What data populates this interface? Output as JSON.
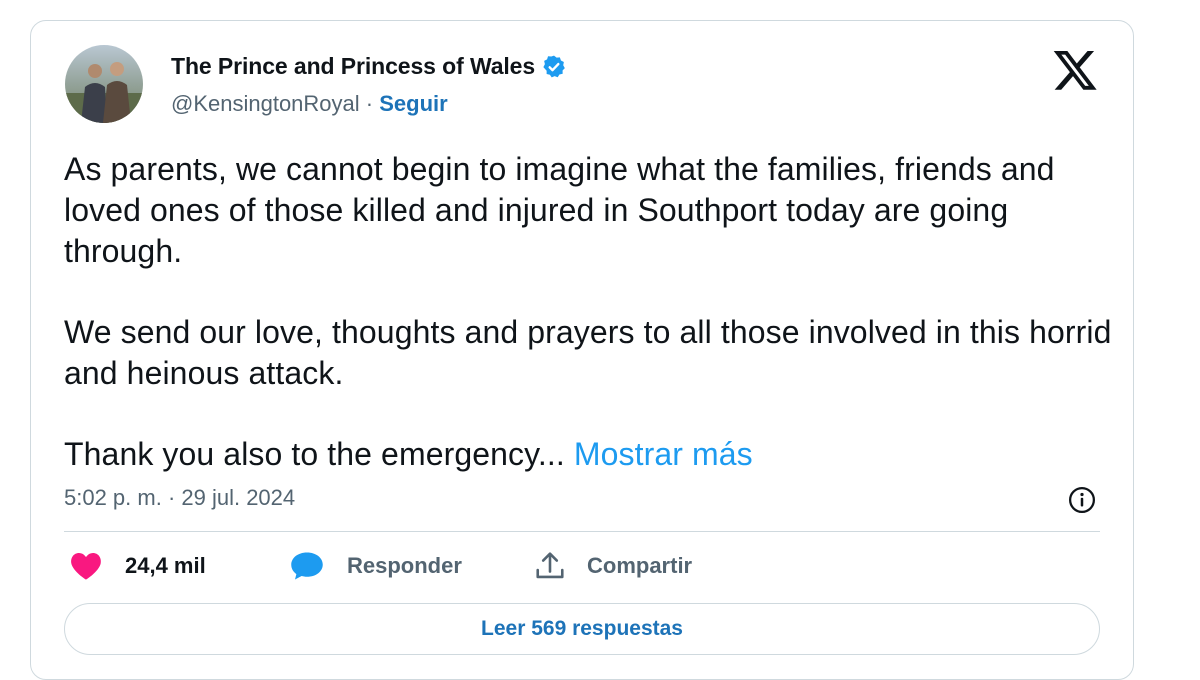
{
  "tweet": {
    "display_name": "The Prince and Princess of Wales",
    "handle": "@KensingtonRoyal",
    "separator": " · ",
    "follow_label": "Seguir",
    "paragraphs": [
      "As parents, we cannot begin to imagine what the families, friends and loved ones of those killed and injured in Southport today are going through.",
      "We send our love, thoughts and prayers to all those involved in this horrid and heinous attack."
    ],
    "truncated_text": "Thank you also to the emergency... ",
    "show_more_label": "Mostrar más",
    "timestamp": "5:02 p. m. · 29 jul. 2024"
  },
  "actions": {
    "likes": "24,4 mil",
    "reply_label": "Responder",
    "share_label": "Compartir"
  },
  "replies_button": "Leer 569 respuestas",
  "colors": {
    "link": "#1d9bf0",
    "follow": "#1d73b8",
    "like": "#f91880",
    "reply": "#1d9bf0",
    "verified": "#1d9bf0"
  },
  "icons": [
    "avatar",
    "verified-badge-icon",
    "x-logo-icon",
    "info-icon",
    "heart-icon",
    "reply-bubble-icon",
    "share-icon"
  ]
}
